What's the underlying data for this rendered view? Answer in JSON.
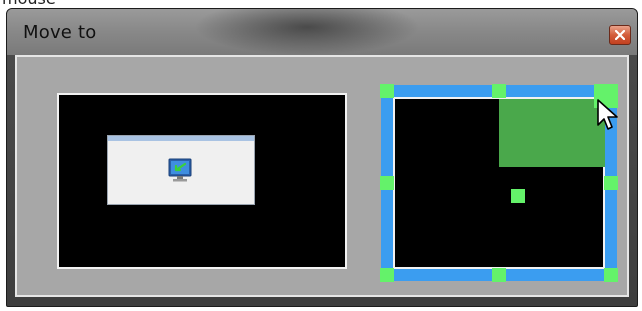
{
  "top_caption": "mouse",
  "window": {
    "title": "Move to",
    "close_icon": "close-icon"
  },
  "colors": {
    "selection_border": "#3b9df0",
    "handles": "#64f26a",
    "target_area": "#4aa84b",
    "client_bg": "#a7a7a7"
  },
  "icons": {
    "mini_window_icon": "monitor-arrow-icon",
    "cursor": "mouse-pointer-icon"
  }
}
